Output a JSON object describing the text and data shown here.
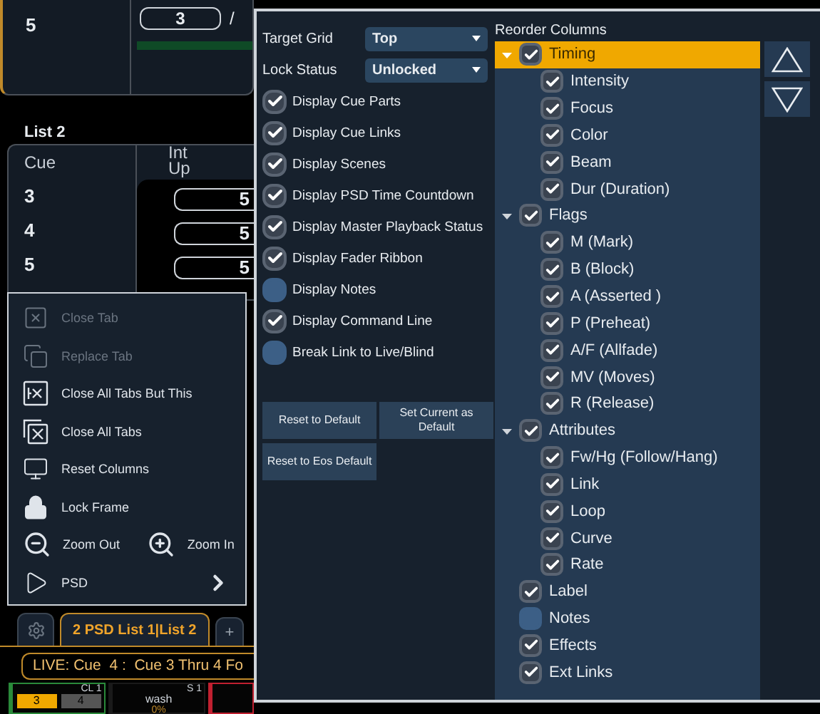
{
  "top_cue": {
    "cue": "5",
    "field": "3",
    "separator": "/",
    "progress": {
      "level": 1
    }
  },
  "cue_list": {
    "title": "List 2",
    "columns": [
      "Cue",
      "Int Up"
    ],
    "rows": [
      {
        "cue": "3",
        "int_up": "5"
      },
      {
        "cue": "4",
        "int_up": "5"
      },
      {
        "cue": "5",
        "int_up": "5"
      }
    ]
  },
  "context_menu": {
    "items": [
      {
        "kind": "close-tab",
        "label": "Close Tab",
        "disabled": true
      },
      {
        "kind": "replace-tab",
        "label": "Replace Tab",
        "disabled": true
      },
      {
        "kind": "close-others",
        "label": "Close All Tabs But This",
        "disabled": false
      },
      {
        "kind": "close-all",
        "label": "Close All Tabs",
        "disabled": false
      },
      {
        "kind": "reset-columns",
        "label": "Reset Columns",
        "disabled": false
      },
      {
        "kind": "lock",
        "label": "Lock Frame",
        "disabled": false
      },
      {
        "kind": "zoom",
        "zoom_out": "Zoom Out",
        "zoom_in": "Zoom In",
        "disabled": false
      },
      {
        "kind": "submenu",
        "label": "PSD",
        "disabled": false
      }
    ]
  },
  "tab_bar": {
    "tabs": [
      {
        "label": "2 PSD List 1|List 2",
        "selected": true
      }
    ],
    "add_button": "+"
  },
  "live_bar": "LIVE: Cue  4 :  Cue 3 Thru 4 Fo",
  "faders": [
    {
      "kind": "cue",
      "tag": "CL 1",
      "buttons": [
        {
          "label": "3",
          "selected": true
        },
        {
          "label": "4",
          "selected": false
        }
      ]
    },
    {
      "kind": "sub",
      "tag": "S 1",
      "label": "wash",
      "reading": "0%"
    },
    {
      "kind": "red"
    }
  ],
  "dialog": {
    "dropdowns": [
      {
        "label": "Target Grid",
        "value": "Top"
      },
      {
        "label": "Lock Status",
        "value": "Unlocked"
      }
    ],
    "options": [
      {
        "label": "Display Cue Parts",
        "checked": true
      },
      {
        "label": "Display Cue Links",
        "checked": true
      },
      {
        "label": "Display Scenes",
        "checked": true
      },
      {
        "label": "Display PSD Time Countdown",
        "checked": true
      },
      {
        "label": "Display Master Playback Status",
        "checked": true
      },
      {
        "label": "Display Fader Ribbon",
        "checked": true
      },
      {
        "label": "Display Notes",
        "checked": false
      },
      {
        "label": "Display Command Line",
        "checked": true
      },
      {
        "label": "Break Link to Live/Blind",
        "checked": false
      }
    ],
    "buttons": [
      "Reset to Default",
      "Set Current as Default",
      "Reset to Eos Default"
    ],
    "reorder": {
      "title": "Reorder Columns",
      "tree": [
        {
          "label": "Timing",
          "checked": true,
          "selected": true,
          "expanded": true,
          "children": [
            {
              "label": "Intensity",
              "checked": true,
              "selected": false
            },
            {
              "label": "Focus",
              "checked": true,
              "selected": false
            },
            {
              "label": "Color",
              "checked": true,
              "selected": false
            },
            {
              "label": "Beam",
              "checked": true,
              "selected": false
            },
            {
              "label": "Dur (Duration)",
              "checked": true,
              "selected": false
            }
          ]
        },
        {
          "label": "Flags",
          "checked": true,
          "selected": false,
          "expanded": true,
          "children": [
            {
              "label": "M (Mark)",
              "checked": true,
              "selected": false
            },
            {
              "label": "B (Block)",
              "checked": true,
              "selected": false
            },
            {
              "label": "A (Asserted )",
              "checked": true,
              "selected": false
            },
            {
              "label": "P (Preheat)",
              "checked": true,
              "selected": false
            },
            {
              "label": "A/F (Allfade)",
              "checked": true,
              "selected": false
            },
            {
              "label": "MV (Moves)",
              "checked": true,
              "selected": false
            },
            {
              "label": "R (Release)",
              "checked": true,
              "selected": false
            }
          ]
        },
        {
          "label": "Attributes",
          "checked": true,
          "selected": false,
          "expanded": true,
          "children": [
            {
              "label": "Fw/Hg (Follow/Hang)",
              "checked": true,
              "selected": false
            },
            {
              "label": "Link",
              "checked": true,
              "selected": false
            },
            {
              "label": "Loop",
              "checked": true,
              "selected": false
            },
            {
              "label": "Curve",
              "checked": true,
              "selected": false
            },
            {
              "label": "Rate",
              "checked": true,
              "selected": false
            }
          ]
        },
        {
          "label": "Label",
          "checked": true,
          "selected": false
        },
        {
          "label": "Notes",
          "checked": false,
          "selected": false
        },
        {
          "label": "Effects",
          "checked": true,
          "selected": false
        },
        {
          "label": "Ext Links",
          "checked": true,
          "selected": false
        }
      ]
    }
  }
}
